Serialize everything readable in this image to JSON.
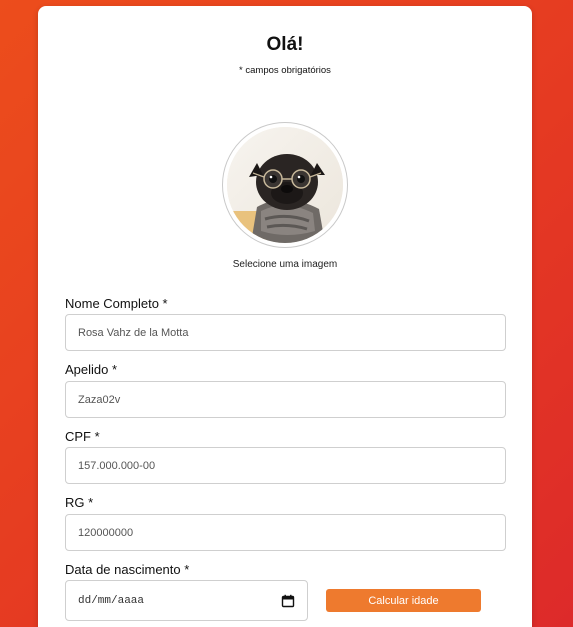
{
  "header": {
    "title": "Olá!",
    "subtitle": "* campos obrigatórios"
  },
  "avatar": {
    "caption": "Selecione uma imagem",
    "image": "pug-with-glasses-photo"
  },
  "fields": [
    {
      "label": "Nome Completo *",
      "value": "Rosa Vahz de la Motta"
    },
    {
      "label": "Apelido *",
      "value": "Zaza02v"
    },
    {
      "label": "CPF *",
      "value": "157.000.000-00"
    },
    {
      "label": "RG *",
      "value": "120000000"
    }
  ],
  "birth": {
    "label": "Data de nascimento *",
    "placeholder": "dd/mm/aaaa",
    "icon": "calendar-icon"
  },
  "actions": {
    "calc_label": "Calcular idade"
  },
  "colors": {
    "background": "#e6401f",
    "button": "#ee7a2e",
    "card": "#ffffff"
  }
}
